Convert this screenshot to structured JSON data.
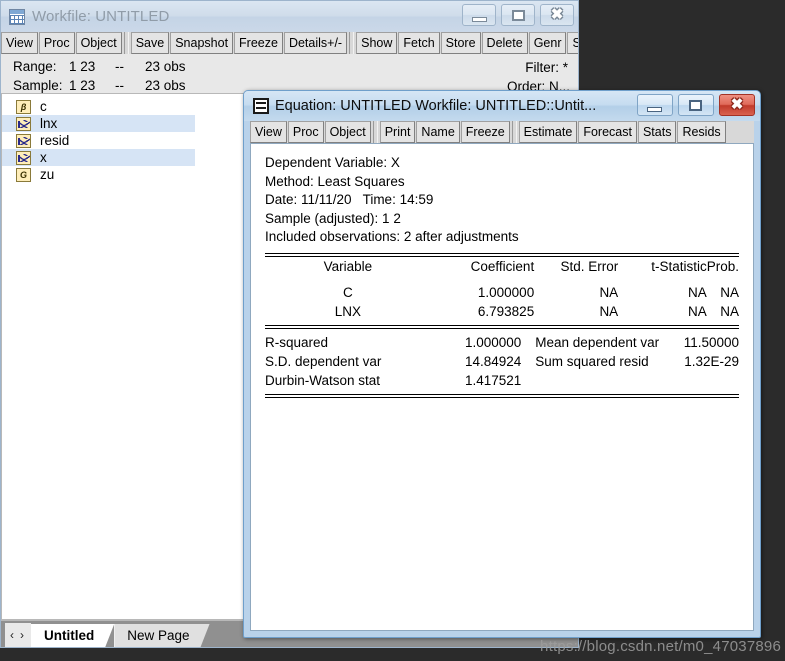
{
  "workfile": {
    "title": "Workfile: UNTITLED",
    "title_icon": "workfile-grid-icon",
    "window_buttons": {
      "minimize": "minimize-icon",
      "maximize": "maximize-icon",
      "close": "close-icon"
    },
    "toolbar": [
      {
        "label": "View"
      },
      {
        "label": "Proc"
      },
      {
        "label": "Object"
      },
      {
        "sep": true
      },
      {
        "label": "Save"
      },
      {
        "label": "Snapshot"
      },
      {
        "label": "Freeze"
      },
      {
        "label": "Details+/-"
      },
      {
        "sep": true
      },
      {
        "label": "Show"
      },
      {
        "label": "Fetch"
      },
      {
        "label": "Store"
      },
      {
        "label": "Delete"
      },
      {
        "label": "Genr"
      },
      {
        "label": "Sample"
      }
    ],
    "info": {
      "range_label": "Range:",
      "range_value": "1 23",
      "range_dash": "--",
      "range_obs": "23 obs",
      "sample_label": "Sample:",
      "sample_value": "1 23",
      "sample_dash": "--",
      "sample_obs": "23 obs",
      "filter": "Filter: *",
      "order": "Order: N..."
    },
    "objects": [
      {
        "name": "c",
        "icon": "coefficient-beta-icon",
        "icon_glyph": "β",
        "type": "coef",
        "selected": false
      },
      {
        "name": "lnx",
        "icon": "series-icon",
        "icon_glyph": "",
        "type": "series",
        "selected": true
      },
      {
        "name": "resid",
        "icon": "series-icon",
        "icon_glyph": "",
        "type": "series",
        "selected": false
      },
      {
        "name": "x",
        "icon": "series-icon",
        "icon_glyph": "",
        "type": "series",
        "selected": true
      },
      {
        "name": "zu",
        "icon": "group-icon",
        "icon_glyph": "G",
        "type": "group",
        "selected": false
      }
    ],
    "tabs": {
      "prev_arrow": "‹",
      "next_arrow": "›",
      "pages": [
        {
          "label": "Untitled",
          "active": true
        },
        {
          "label": "New Page",
          "active": false
        }
      ]
    }
  },
  "equation": {
    "title": "Equation: UNTITLED   Workfile: UNTITLED::Untit...",
    "title_icon": "equation-icon",
    "window_buttons": {
      "minimize": "minimize-icon",
      "maximize": "maximize-icon",
      "close": "close-icon"
    },
    "toolbar": [
      {
        "label": "View"
      },
      {
        "label": "Proc"
      },
      {
        "label": "Object"
      },
      {
        "sep": true
      },
      {
        "label": "Print"
      },
      {
        "label": "Name"
      },
      {
        "label": "Freeze"
      },
      {
        "sep": true
      },
      {
        "label": "Estimate"
      },
      {
        "label": "Forecast"
      },
      {
        "label": "Stats"
      },
      {
        "label": "Resids"
      }
    ],
    "output": {
      "header_lines": [
        "Dependent Variable: X",
        "Method: Least Squares",
        "Date: 11/11/20   Time: 14:59",
        "Sample (adjusted): 1 2",
        "Included observations: 2 after adjustments"
      ],
      "columns": [
        "Variable",
        "Coefficient",
        "Std. Error",
        "t-Statistic",
        "Prob."
      ],
      "rows": [
        {
          "variable": "C",
          "coefficient": "1.000000",
          "std_error": "NA",
          "t_statistic": "NA",
          "prob": "NA"
        },
        {
          "variable": "LNX",
          "coefficient": "6.793825",
          "std_error": "NA",
          "t_statistic": "NA",
          "prob": "NA"
        }
      ],
      "stats": [
        {
          "label_left": "R-squared",
          "value_left": "1.000000",
          "label_right": "Mean dependent var",
          "value_right": "11.50000"
        },
        {
          "label_left": "S.D. dependent var",
          "value_left": "14.84924",
          "label_right": "Sum squared resid",
          "value_right": "1.32E-29"
        },
        {
          "label_left": "Durbin-Watson stat",
          "value_left": "1.417521",
          "label_right": "",
          "value_right": ""
        }
      ]
    }
  },
  "watermark": {
    "text": "https://blog.csdn.net/m0_47037896"
  }
}
